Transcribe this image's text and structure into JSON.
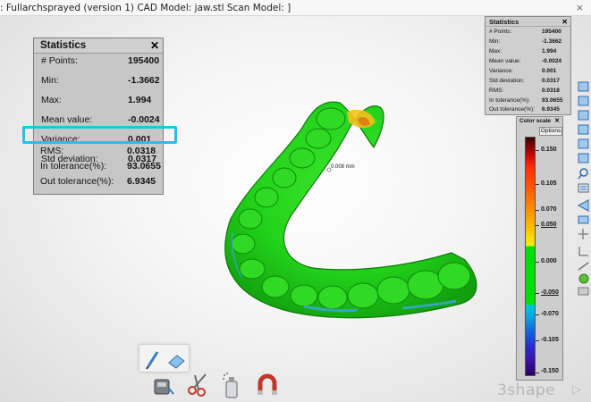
{
  "window": {
    "title": ": Fullarchsprayed (version 1) CAD Model: jaw.stl Scan Model: ]",
    "close_glyph": "×"
  },
  "stats_panel": {
    "title": "Statistics",
    "close_glyph": "✕",
    "rows": [
      {
        "label": "# Points:",
        "value": "195400"
      },
      {
        "label": "Min:",
        "value": "-1.3662"
      },
      {
        "label": "Max:",
        "value": "1.994"
      },
      {
        "label": "Mean value:",
        "value": "-0.0024"
      },
      {
        "label": "Variance:",
        "value": "0.001"
      },
      {
        "label": "Std deviation:",
        "value": "0.0317"
      },
      {
        "label": "RMS:",
        "value": "0.0318"
      },
      {
        "label": "In tolerance(%):",
        "value": "93.0655"
      },
      {
        "label": "Out tolerance(%):",
        "value": "6.9345"
      }
    ]
  },
  "stats_panel_small": {
    "title": "Statistics",
    "close_glyph": "✕",
    "rows": [
      {
        "label": "# Points:",
        "value": "195400"
      },
      {
        "label": "Min:",
        "value": "-1.3662"
      },
      {
        "label": "Max:",
        "value": "1.994"
      },
      {
        "label": "Mean value:",
        "value": "-0.0024"
      },
      {
        "label": "Variance:",
        "value": "0.001"
      },
      {
        "label": "Std deviation:",
        "value": "0.0317"
      },
      {
        "label": "RMS:",
        "value": "0.0318"
      },
      {
        "label": "In tolerance(%):",
        "value": "93.0655"
      },
      {
        "label": "Out tolerance(%):",
        "value": "6.9345"
      }
    ]
  },
  "color_scale": {
    "title": "Color scale",
    "close_glyph": "✕",
    "options_label": "Options",
    "ticks": [
      "0.150",
      "0.105",
      "0.070",
      "0.050",
      "0.000",
      "-0.050",
      "-0.070",
      "-0.105",
      "-0.150"
    ]
  },
  "model": {
    "annotation": "0.008 mm"
  },
  "highlight_color": "#27c0e3",
  "logo": {
    "text": "3shape",
    "mark": "▷"
  },
  "icons": {
    "bottom_tools": [
      "pen-icon",
      "eraser-icon",
      "scan-tool-icon",
      "scissors-icon",
      "spray-can-icon",
      "magnet-icon"
    ],
    "right_toolbar": [
      "view-front-icon",
      "view-back-icon",
      "view-left-icon",
      "view-right-icon",
      "view-top-icon",
      "view-bottom-icon",
      "zoom-icon",
      "list-icon",
      "cut-icon",
      "camera-icon",
      "move-icon",
      "axis-icon",
      "measure-icon",
      "texture-icon",
      "settings-icon",
      "close-icon"
    ]
  }
}
